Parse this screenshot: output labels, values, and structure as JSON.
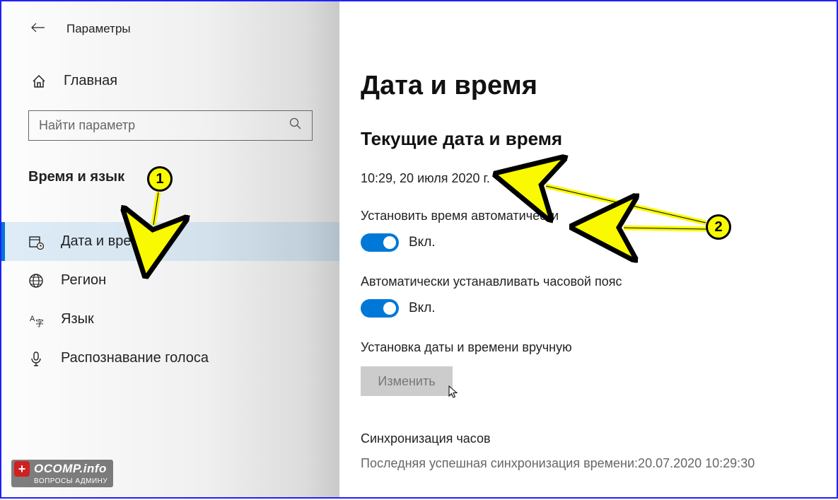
{
  "header": {
    "title": "Параметры"
  },
  "sidebar": {
    "home": "Главная",
    "search_placeholder": "Найти параметр",
    "category": "Время и язык",
    "items": [
      {
        "label": "Дата и время"
      },
      {
        "label": "Регион"
      },
      {
        "label": "Язык"
      },
      {
        "label": "Распознавание голоса"
      }
    ]
  },
  "main": {
    "title": "Дата и время",
    "section_current": "Текущие дата и время",
    "current_datetime": "10:29, 20 июля 2020 г.",
    "auto_time_label": "Установить время автоматически",
    "auto_tz_label": "Автоматически устанавливать часовой пояс",
    "toggle_on": "Вкл.",
    "manual_label": "Установка даты и времени вручную",
    "change_button": "Изменить",
    "sync_title": "Синхронизация часов",
    "sync_text": "Последняя успешная синхронизация времени:20.07.2020 10:29:30"
  },
  "annotations": {
    "badge1": "1",
    "badge2": "2"
  },
  "watermark": {
    "main": "OCOMP.info",
    "sub": "ВОПРОСЫ АДМИНУ"
  }
}
